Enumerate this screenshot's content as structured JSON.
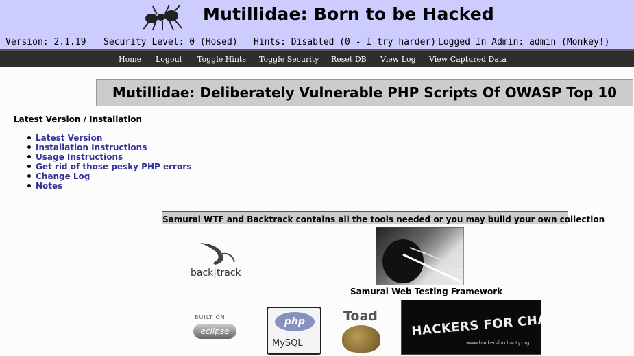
{
  "header": {
    "title": "Mutillidae: Born to be Hacked",
    "logo_icon": "ant-icon"
  },
  "status": {
    "version": "Version: 2.1.19",
    "security": "Security Level: 0 (Hosed)",
    "hints": "Hints: Disabled (0 - I try harder)",
    "login": "Logged In Admin: admin (Monkey!)"
  },
  "nav": {
    "items": [
      "Home",
      "Logout",
      "Toggle Hints",
      "Toggle Security",
      "Reset DB",
      "View Log",
      "View Captured Data"
    ]
  },
  "main": {
    "heading": "Mutillidae: Deliberately Vulnerable PHP Scripts Of OWASP Top 10",
    "section_title": "Latest Version / Installation",
    "links": [
      "Latest Version",
      "Installation Instructions",
      "Usage Instructions",
      "Get rid of those pesky PHP errors",
      "Change Log",
      "Notes"
    ],
    "tools_banner": "Samurai WTF and Backtrack contains all the tools needed or you may build your own collection",
    "samurai_caption": "Samurai Web Testing Framework"
  },
  "logos": {
    "backtrack": "back|track",
    "eclipse_top": "BUILT ON",
    "eclipse": "eclipse",
    "php": "php",
    "mysql": "MySQL",
    "toad": "Toad",
    "hfc": "HACKERS FOR CHARITY",
    "hfc_url": "www.hackersforcharity.org"
  },
  "colors": {
    "banner_bg": "#ccccff",
    "nav_bg": "#2e2e2e",
    "link": "#333399",
    "heading_bg": "#cccccc"
  }
}
